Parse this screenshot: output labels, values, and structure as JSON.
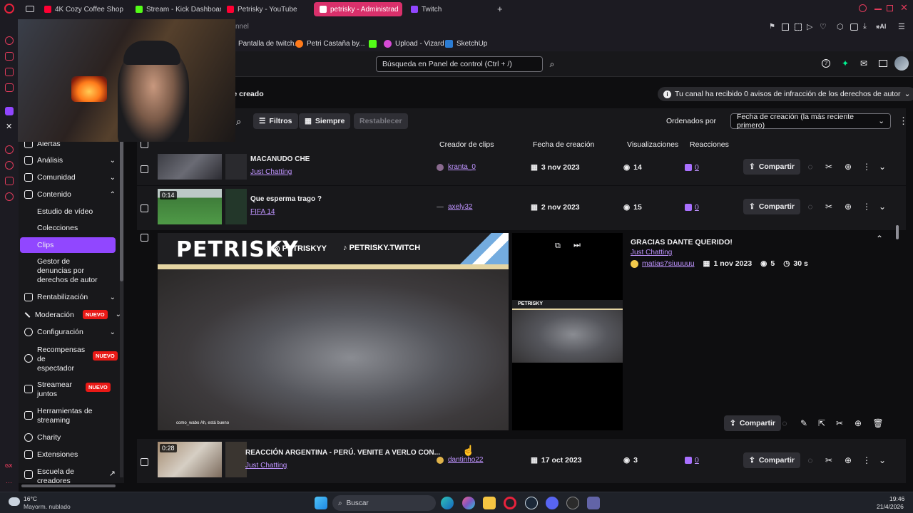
{
  "browser_tabs": [
    {
      "label": "4K Cozy Coffee Shop with",
      "color": "#ff0033"
    },
    {
      "label": "Stream - Kick Dashboard",
      "color": "#53fc18"
    },
    {
      "label": "Petrisky - YouTube",
      "color": "#ff0033"
    },
    {
      "label": "petrisky - Administrad",
      "color": "#9146ff"
    },
    {
      "label": "Twitch",
      "color": "#9146ff"
    }
  ],
  "address_partial": "nnel",
  "bookmarks": [
    {
      "label": "Pantalla de twitch...",
      "color": "#9146ff"
    },
    {
      "label": "Petri Castaña by...",
      "color": "#ff7a1a"
    },
    {
      "label": "",
      "color": "#53fc18"
    },
    {
      "label": "Upload - Vizard",
      "color": "#d64bd6"
    },
    {
      "label": "SketchUp",
      "color": "#2b7cd3"
    }
  ],
  "search": {
    "placeholder": "Búsqueda en Panel de control (Ctrl + /)"
  },
  "page": {
    "title_partial": "ne creado",
    "notice": "Tu canal ha recibido 0 avisos de infracción de los derechos de autor"
  },
  "filters": {
    "filtros": "Filtros",
    "siempre": "Siempre",
    "restablecer": "Restablecer",
    "sort_label": "Ordenados por",
    "sort_value": "Fecha de creación (la más reciente primero)"
  },
  "columns": {
    "creator": "Creador de clips",
    "date": "Fecha de creación",
    "views": "Visualizaciones",
    "reactions": "Reacciones"
  },
  "nav": {
    "alertas": "Alertas",
    "analisis": "Análisis",
    "comunidad": "Comunidad",
    "contenido": "Contenido",
    "estudio": "Estudio de vídeo",
    "colecciones": "Colecciones",
    "clips": "Clips",
    "gestor": "Gestor de denuncias por derechos de autor",
    "rentabilizacion": "Rentabilización",
    "moderacion": "Moderación",
    "configuracion": "Configuración",
    "recompensas": "Recompensas de espectador",
    "streamear": "Streamear juntos",
    "herramientas": "Herramientas de streaming",
    "charity": "Charity",
    "extensiones": "Extensiones",
    "escuela": "Escuela de creadores",
    "nuevo": "NUEVO"
  },
  "clips": [
    {
      "title": "MACANUDO CHE",
      "category": "Just Chatting",
      "creator": "kranta_0",
      "date": "3 nov 2023",
      "views": "14",
      "reactions": "0",
      "share": "Compartir",
      "duration": ""
    },
    {
      "title": "Que esperma trago ?",
      "category": "FIFA 14",
      "creator": "axely32",
      "date": "2 nov 2023",
      "views": "15",
      "reactions": "0",
      "share": "Compartir",
      "duration": "0:14"
    },
    {
      "title": "REACCIÓN ARGENTINA - PERÚ. VENITE A VERLO CON...",
      "category": "Just Chatting",
      "creator": "dantinho22",
      "date": "17 oct 2023",
      "views": "3",
      "reactions": "0",
      "share": "Compartir",
      "duration": "0:28"
    }
  ],
  "expanded": {
    "title": "GRACIAS DANTE QUERIDO!",
    "category": "Just Chatting",
    "creator": "matias7siuuuuu",
    "date": "1 nov 2023",
    "views": "5",
    "length": "30 s",
    "share": "Compartir",
    "brand": "PETRISKY",
    "ig": "PETRISKYY",
    "tt": "PETRISKY.TWITCH",
    "caption": "como_wabo  Ah, está bueno"
  },
  "taskbar": {
    "temp": "16°C",
    "weather": "Mayorm. nublado",
    "search": "Buscar",
    "time": "19:46",
    "date": "21/4/2026"
  }
}
